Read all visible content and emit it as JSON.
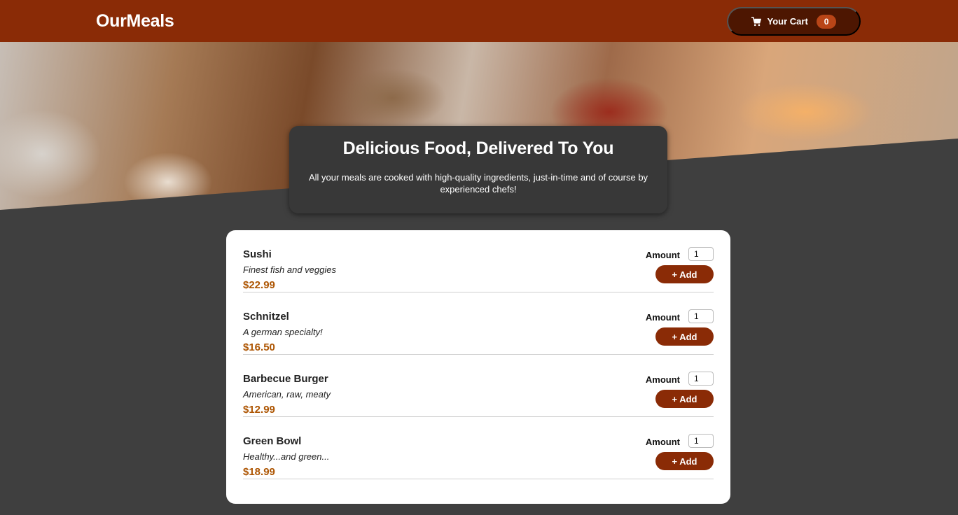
{
  "header": {
    "logo": "OurMeals",
    "cart": {
      "label": "Your Cart",
      "count": "0",
      "icon": "cart-icon"
    }
  },
  "summary": {
    "title": "Delicious Food, Delivered To You",
    "text": "All your meals are cooked with high-quality ingredients, just-in-time and of course by experienced chefs!"
  },
  "meals": [
    {
      "name": "Sushi",
      "description": "Finest fish and veggies",
      "price": "$22.99",
      "amount_label": "Amount",
      "amount": "1",
      "add_label": "+ Add"
    },
    {
      "name": "Schnitzel",
      "description": "A german specialty!",
      "price": "$16.50",
      "amount_label": "Amount",
      "amount": "1",
      "add_label": "+ Add"
    },
    {
      "name": "Barbecue Burger",
      "description": "American, raw, meaty",
      "price": "$12.99",
      "amount_label": "Amount",
      "amount": "1",
      "add_label": "+ Add"
    },
    {
      "name": "Green Bowl",
      "description": "Healthy...and green...",
      "price": "$18.99",
      "amount_label": "Amount",
      "amount": "1",
      "add_label": "+ Add"
    }
  ],
  "colors": {
    "header": "#8a2b06",
    "cart_button": "#4d1601",
    "cart_badge": "#b94517",
    "background": "#3f3f3f",
    "price": "#ad5502"
  }
}
